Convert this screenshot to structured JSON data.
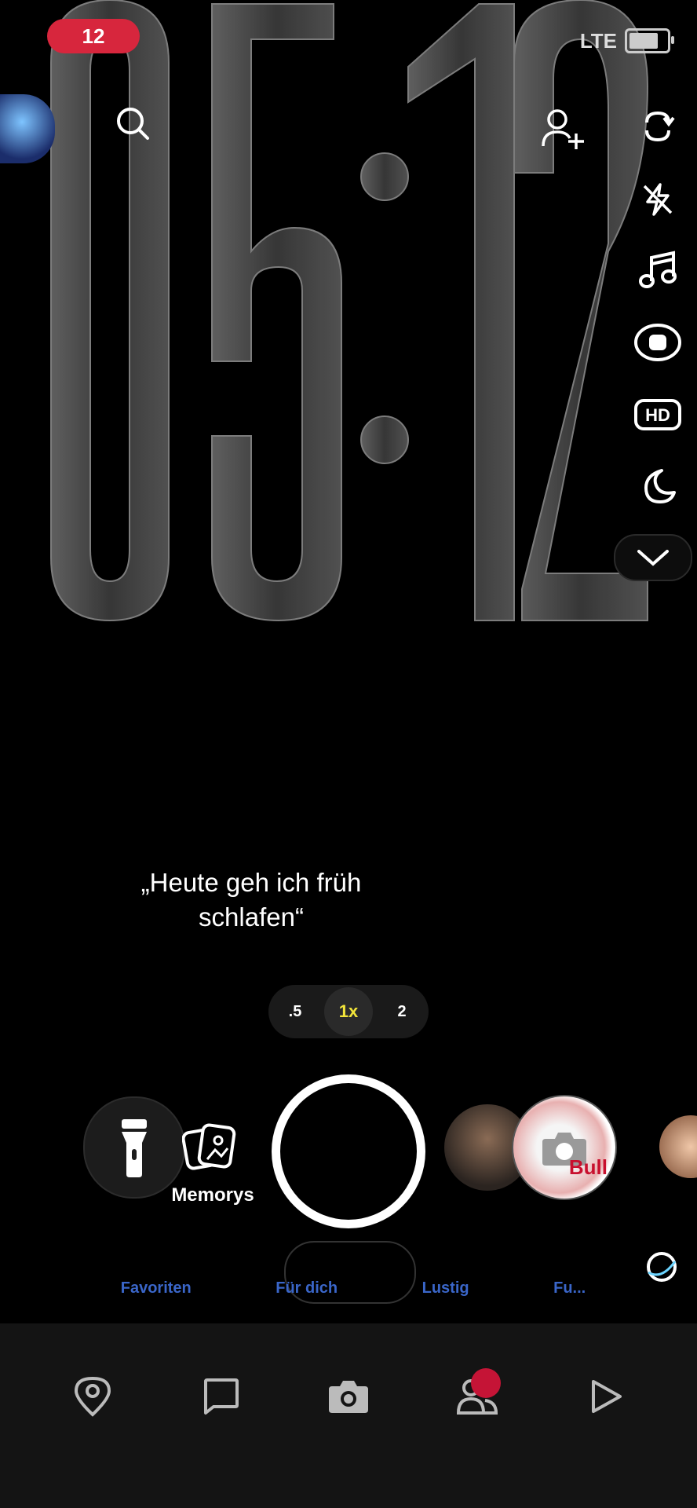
{
  "status_bar": {
    "notification_count": "12",
    "network": "LTE"
  },
  "clock": {
    "time": "05:12"
  },
  "caption": {
    "text": "„Heute geh ich früh schlafen“"
  },
  "zoom": {
    "options": [
      ".5",
      "1x",
      "2"
    ],
    "selected": "1x"
  },
  "capture_row": {
    "memories_label": "Memorys",
    "lens_brand_text": "Bull"
  },
  "lens_tabs": [
    "Favoriten",
    "Für dich",
    "Lustig",
    "Fu..."
  ],
  "right_toolbar": [
    "flip-camera-icon",
    "flash-off-icon",
    "music-icon",
    "dual-camera-icon",
    "hd-icon",
    "night-mode-icon",
    "chevron-down-icon"
  ],
  "bottom_nav": [
    "map-icon",
    "chat-icon",
    "camera-icon",
    "stories-icon",
    "spotlight-icon"
  ],
  "colors": {
    "accent_yellow": "#f1e43a",
    "badge_red": "#c51436",
    "nav_bg": "#141414"
  }
}
